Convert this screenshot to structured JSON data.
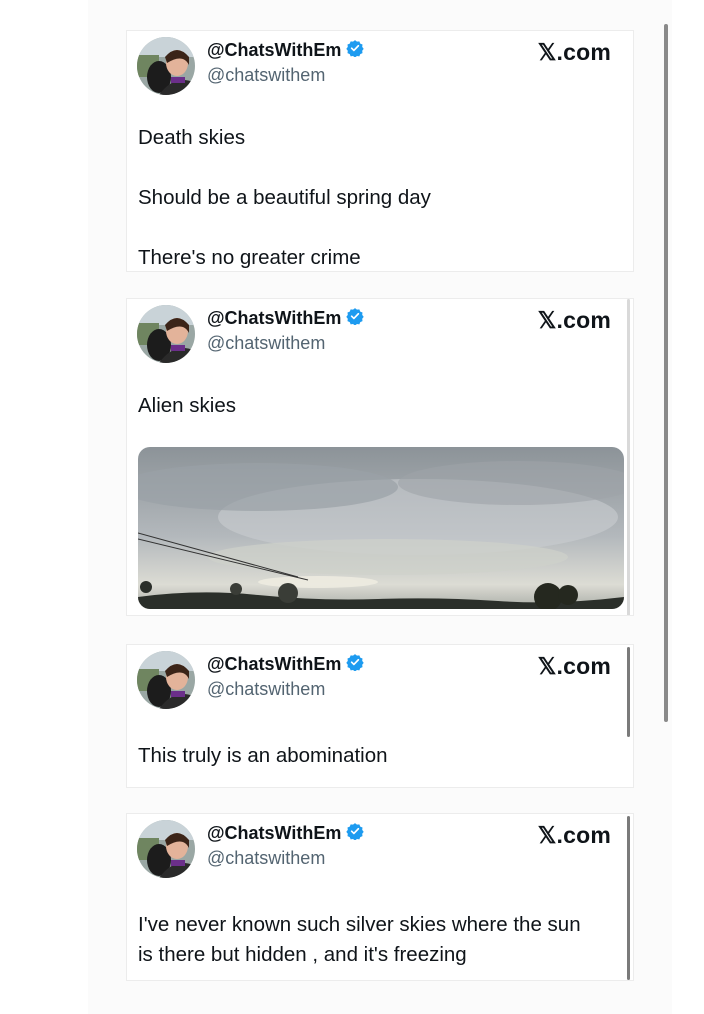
{
  "colors": {
    "verified": "#1d9bf0",
    "text_primary": "#0f1419",
    "text_secondary": "#536471"
  },
  "icons": {
    "verified": "verified-badge-icon",
    "avatar": "profile-photo"
  },
  "posts": [
    {
      "display_name": "@ChatsWithEm",
      "handle": "@chatswithem",
      "site": "𝕏.com",
      "lines": [
        "Death skies",
        "Should be a beautiful spring day",
        "There's no greater crime"
      ]
    },
    {
      "display_name": "@ChatsWithEm",
      "handle": "@chatswithem",
      "site": "𝕏.com",
      "lines": [
        "Alien skies"
      ],
      "media": "cloudy-sky-photo"
    },
    {
      "display_name": "@ChatsWithEm",
      "handle": "@chatswithem",
      "site": "𝕏.com",
      "lines": [
        "This truly is an abomination"
      ]
    },
    {
      "display_name": "@ChatsWithEm",
      "handle": "@chatswithem",
      "site": "𝕏.com",
      "lines": [
        "I've never known such silver skies where the sun",
        "is there but hidden , and it's freezing"
      ]
    }
  ]
}
